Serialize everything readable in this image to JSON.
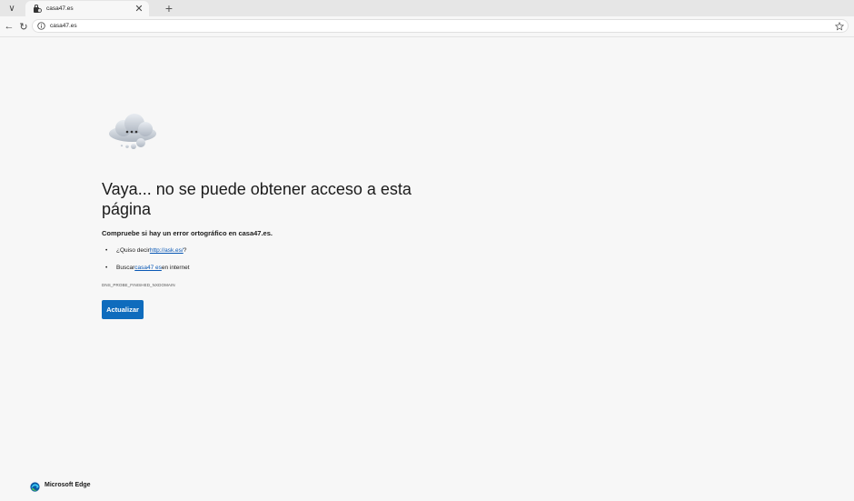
{
  "browser": {
    "tab": {
      "title": "casa47.es",
      "favicon": "site-favicon",
      "close_glyph": "✕"
    },
    "new_tab_glyph": "+",
    "tab_list_glyph": "∨",
    "back_glyph": "←",
    "refresh_glyph": "↻",
    "address": {
      "url": "casa47.es",
      "site_info_icon": "info-icon",
      "favorite_icon": "star-icon"
    }
  },
  "error_page": {
    "illustration": "cloud-icon",
    "heading": "Vaya... no se puede obtener acceso a esta página",
    "subheading": "Compruebe si hay un error ortográfico en casa47.es.",
    "suggestions": [
      {
        "prefix": "¿Quiso decir ",
        "link": "http://ask.es/",
        "suffix": "?"
      },
      {
        "prefix": "Buscar ",
        "link": "casa47 es",
        "suffix": " en internet"
      }
    ],
    "error_code": "DNS_PROBE_FINISHED_NXDOMAIN",
    "refresh_label": "Actualizar"
  },
  "branding": {
    "name": "Microsoft Edge"
  },
  "colors": {
    "accent": "#0f6cbd",
    "link": "#0a58b5",
    "background": "#f7f7f7"
  }
}
